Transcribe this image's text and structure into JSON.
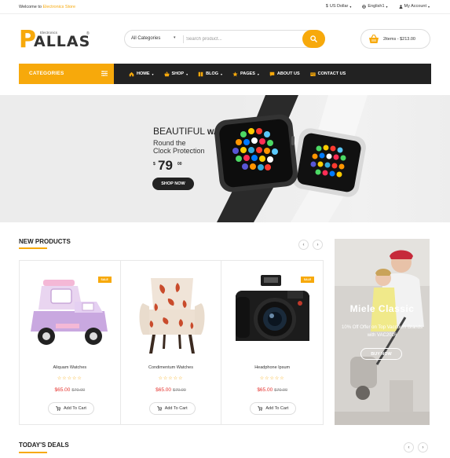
{
  "topbar": {
    "welcome_prefix": "Welcome to ",
    "welcome_store": "Electronics Store",
    "currency": "US Dollar",
    "language": "English1",
    "account": "My Account"
  },
  "brand": {
    "logo_first": "P",
    "logo_rest": "ALLAS",
    "tagline": "Electronics",
    "registered": "®",
    "accent_color": "#f7a90b"
  },
  "search": {
    "category": "All Categories",
    "placeholder": "Search product..."
  },
  "cart": {
    "summary": "2items - $213.00"
  },
  "nav": {
    "categories_label": "CATEGORIES",
    "items": [
      {
        "label": "HOME",
        "icon": "home-icon"
      },
      {
        "label": "SHOP",
        "icon": "basket-icon"
      },
      {
        "label": "BLOG",
        "icon": "book-icon"
      },
      {
        "label": "PAGES",
        "icon": "star-icon"
      },
      {
        "label": "ABOUT US",
        "icon": "chat-icon"
      },
      {
        "label": "CONTACT US",
        "icon": "contact-card-icon"
      }
    ]
  },
  "hero": {
    "title_big": "BEAUTIFUL",
    "title_small": "WATCH",
    "subtitle_line1": "Round the",
    "subtitle_line2": "Clock Protection",
    "currency": "$",
    "price": "79",
    "cents": "00",
    "button": "SHOP NOW"
  },
  "new_products": {
    "title": "NEW PRODUCTS",
    "prev": "‹",
    "next": "›",
    "items": [
      {
        "name": "Aliquam Watches",
        "sale": "SALE",
        "stars": "☆☆☆☆☆",
        "price": "$65.00",
        "old_price": "$70.00",
        "button": "Add To Cart"
      },
      {
        "name": "Condimentum Watches",
        "sale": "",
        "stars": "☆☆☆☆☆",
        "price": "$65.00",
        "old_price": "$70.00",
        "button": "Add To Cart"
      },
      {
        "name": "Headphone Ipsum",
        "sale": "SALE",
        "stars": "☆☆☆☆☆",
        "price": "$65.00",
        "old_price": "$70.00",
        "button": "Add To Cart"
      }
    ]
  },
  "promo": {
    "title": "Miele Classic",
    "desc": "10% Off Offer on Top Vaccuum Brands with VAC2016",
    "button": "BUY NOW"
  },
  "todays_deals": {
    "title": "TODAY'S DEALS",
    "prev": "‹",
    "next": "›"
  }
}
